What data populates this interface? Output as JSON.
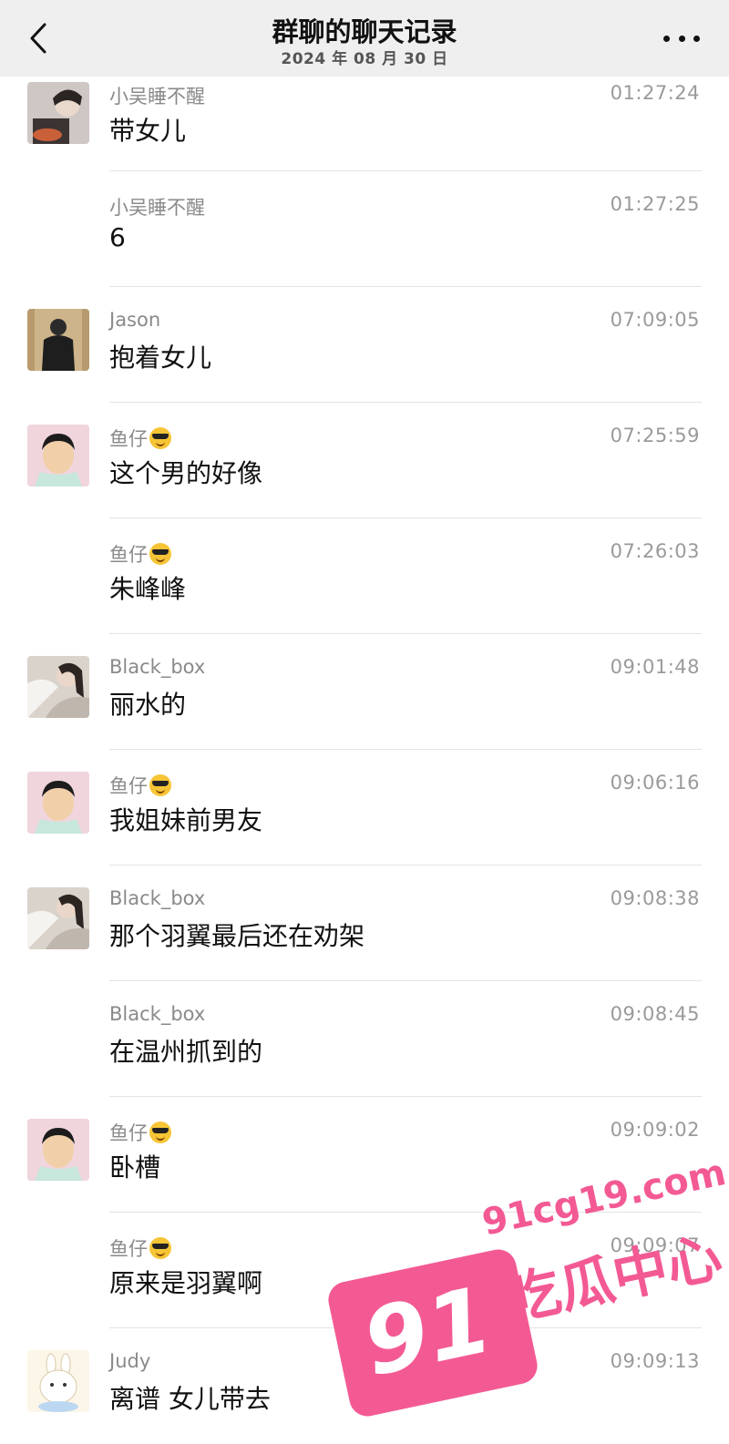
{
  "header": {
    "title": "群聊的聊天记录",
    "subtitle": "2024 年 08 月 30 日",
    "back_icon": "chevron-left-icon",
    "more_icon": "more-dots-icon"
  },
  "messages": [
    {
      "sender": "小吴睡不醒",
      "time": "01:27:24",
      "text": "带女儿",
      "avatar": "avatar-xiaowu",
      "emoji": false
    },
    {
      "sender": "小吴睡不醒",
      "time": "01:27:25",
      "text": "6",
      "avatar": null,
      "emoji": false
    },
    {
      "sender": "Jason",
      "time": "07:09:05",
      "text": "抱着女儿",
      "avatar": "avatar-jason",
      "emoji": false
    },
    {
      "sender": "鱼仔",
      "time": "07:25:59",
      "text": "这个男的好像",
      "avatar": "avatar-yuzai",
      "emoji": true
    },
    {
      "sender": "鱼仔",
      "time": "07:26:03",
      "text": "朱峰峰",
      "avatar": null,
      "emoji": true
    },
    {
      "sender": "Black_box",
      "time": "09:01:48",
      "text": "丽水的",
      "avatar": "avatar-blackbox",
      "emoji": false
    },
    {
      "sender": "鱼仔",
      "time": "09:06:16",
      "text": "我姐妹前男友",
      "avatar": "avatar-yuzai",
      "emoji": true
    },
    {
      "sender": "Black_box",
      "time": "09:08:38",
      "text": "那个羽翼最后还在劝架",
      "avatar": "avatar-blackbox",
      "emoji": false
    },
    {
      "sender": "Black_box",
      "time": "09:08:45",
      "text": "在温州抓到的",
      "avatar": null,
      "emoji": false
    },
    {
      "sender": "鱼仔",
      "time": "09:09:02",
      "text": "卧槽",
      "avatar": "avatar-yuzai",
      "emoji": true
    },
    {
      "sender": "鱼仔",
      "time": "09:09:07",
      "text": "原来是羽翼啊",
      "avatar": null,
      "emoji": true
    },
    {
      "sender": "Judy",
      "time": "09:09:13",
      "text": "离谱  女儿带去",
      "avatar": "avatar-judy",
      "emoji": false
    }
  ],
  "watermark": {
    "badge": "91",
    "url": "91cg19.com",
    "name": "吃瓜中心",
    "color": "#f35a94"
  }
}
